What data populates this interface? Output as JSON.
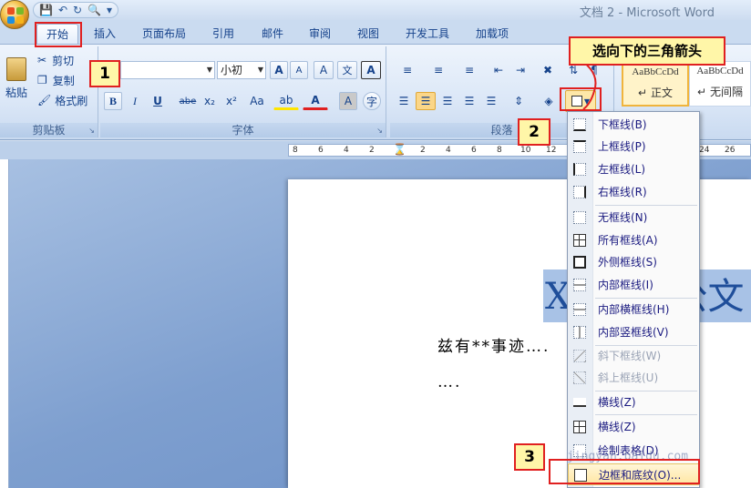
{
  "window": {
    "title": "文档 2 - Microsoft Word"
  },
  "qat": {
    "icons": [
      "save-icon",
      "undo-icon",
      "redo-icon",
      "print-preview-icon",
      "customize-icon"
    ]
  },
  "tabs": [
    "开始",
    "插入",
    "页面布局",
    "引用",
    "邮件",
    "审阅",
    "视图",
    "开发工具",
    "加载项"
  ],
  "clipboard": {
    "paste": "粘贴",
    "cut": "剪切",
    "copy": "复制",
    "format_painter": "格式刷",
    "group_label": "剪贴板"
  },
  "font": {
    "size": "小初",
    "group_label": "字体",
    "bold": "B",
    "italic": "I",
    "underline": "U",
    "strike": "abe",
    "sub": "x₂",
    "sup": "x²",
    "case": "Aa",
    "wen": "文",
    "grow": "A",
    "shrink": "A",
    "clear": "A",
    "pinyin": "文",
    "char_border": "A",
    "char_shade": "A",
    "enclose": "字"
  },
  "paragraph": {
    "group_label": "段落"
  },
  "styles": {
    "normal_sample": "AaBbCcDd",
    "normal": "正文",
    "nospacing_sample": "AaBbCcDd",
    "nospacing": "无间隔",
    "pilcrow": "↵"
  },
  "document": {
    "title": "X",
    "title_tail": "公文",
    "line1": "兹有**事迹….",
    "line2": "…."
  },
  "ruler": {
    "ticks": [
      "8",
      "6",
      "4",
      "2",
      "2",
      "4",
      "6",
      "8",
      "10",
      "12",
      "24",
      "26"
    ]
  },
  "menu": {
    "items": [
      {
        "label": "下框线(B)",
        "icon": "bottom-border-icon",
        "disabled": false
      },
      {
        "label": "上框线(P)",
        "icon": "top-border-icon",
        "disabled": false
      },
      {
        "label": "左框线(L)",
        "icon": "left-border-icon",
        "disabled": false
      },
      {
        "label": "右框线(R)",
        "icon": "right-border-icon",
        "disabled": false
      },
      {
        "label": "无框线(N)",
        "icon": "no-border-icon",
        "disabled": false
      },
      {
        "label": "所有框线(A)",
        "icon": "all-borders-icon",
        "disabled": false
      },
      {
        "label": "外侧框线(S)",
        "icon": "outside-borders-icon",
        "disabled": false
      },
      {
        "label": "内部框线(I)",
        "icon": "inside-borders-icon",
        "disabled": false
      },
      {
        "label": "内部横框线(H)",
        "icon": "inside-horizontal-border-icon",
        "disabled": false
      },
      {
        "label": "内部竖框线(V)",
        "icon": "inside-vertical-border-icon",
        "disabled": false
      },
      {
        "label": "斜下框线(W)",
        "icon": "diagonal-down-border-icon",
        "disabled": true
      },
      {
        "label": "斜上框线(U)",
        "icon": "diagonal-up-border-icon",
        "disabled": true
      },
      {
        "label": "横线(Z)",
        "icon": "horizontal-line-icon",
        "disabled": false
      },
      {
        "label": "横线(Z)",
        "icon": "draw-table-icon",
        "disabled": false
      },
      {
        "label": "绘制表格(D)",
        "icon": "view-gridlines-icon",
        "disabled": false
      },
      {
        "label": "边框和底纹(O)...",
        "icon": "borders-and-shading-icon",
        "disabled": false
      }
    ]
  },
  "annotations": {
    "step1": "1",
    "step2": "2",
    "step3": "3",
    "hint": "选向下的三角箭头",
    "watermark": "jingyan.baidu.com"
  },
  "colors": {
    "accent_red": "#e02020",
    "callout_yellow": "#fff6a8",
    "ribbon_blue": "#dbe7f7",
    "highlight": "#a8c2e6"
  }
}
